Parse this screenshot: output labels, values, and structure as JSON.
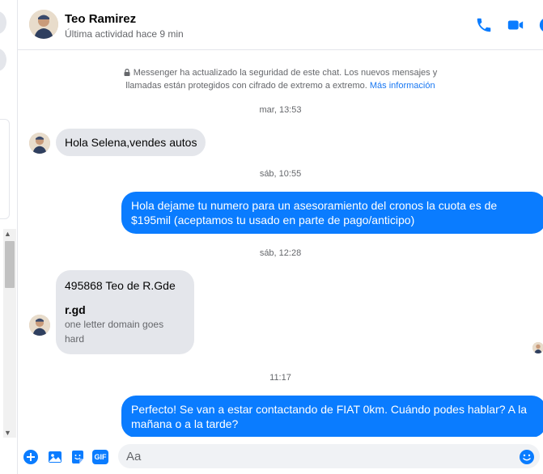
{
  "colors": {
    "accent": "#0a7cff",
    "incoming_bg": "#e4e6eb",
    "meta_text": "#65676b",
    "link": "#1877f2"
  },
  "header": {
    "name": "Teo Ramirez",
    "status": "Última actividad hace 9 min",
    "icons": [
      "phone-icon",
      "video-camera-icon",
      "info-icon"
    ]
  },
  "notice": {
    "text": "Messenger ha actualizado la seguridad de este chat. Los nuevos mensajes y llamadas están protegidos con cifrado de extremo a extremo.",
    "link": "Más información"
  },
  "messages": {
    "ts1": "mar, 13:53",
    "m1": "Hola Selena,vendes autos",
    "ts2": "sáb, 10:55",
    "m2": "Hola dejame tu numero para un asesoramiento del cronos la cuota es de $195mil (aceptamos tu usado en parte de pago/anticipo)",
    "ts3": "sáb, 12:28",
    "m3": "495868 Teo de R.Gde",
    "m3_preview_title": "r.gd",
    "m3_preview_sub": "one letter domain goes hard",
    "ts4": "11:17",
    "m4": "Perfecto!  Se van a estar contactando de FIAT 0km. Cuándo podes hablar? A la mañana o a la tarde?"
  },
  "composer": {
    "placeholder": "Aa",
    "icons": [
      "add-icon",
      "photo-icon",
      "sticker-icon",
      "gif-icon",
      "emoji-icon"
    ],
    "gif_label": "GIF"
  }
}
